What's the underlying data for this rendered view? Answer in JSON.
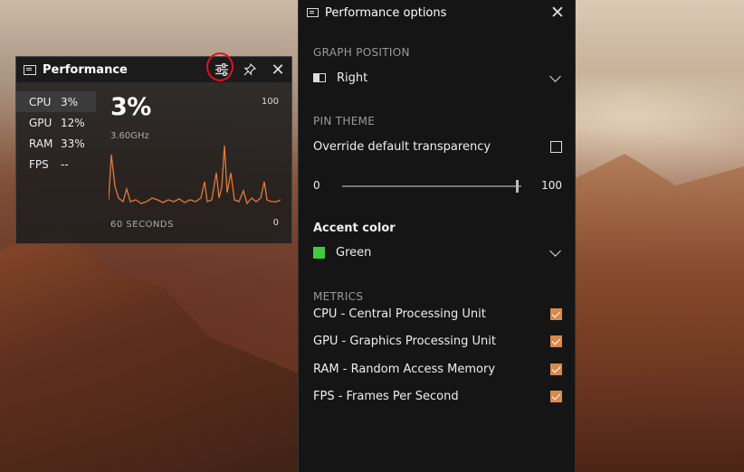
{
  "performance_widget": {
    "title": "Performance",
    "icons": {
      "app": "window-icon",
      "settings": "settings-sliders-icon",
      "pin": "pin-icon",
      "close": "close-icon"
    },
    "metrics": [
      {
        "label": "CPU",
        "value": "3%"
      },
      {
        "label": "GPU",
        "value": "12%"
      },
      {
        "label": "RAM",
        "value": "33%"
      },
      {
        "label": "FPS",
        "value": "--"
      }
    ],
    "selected_metric": "CPU",
    "current_value": "3%",
    "frequency": "3.60GHz",
    "axis_max": "100",
    "axis_min": "0",
    "time_window_label": "60 SECONDS",
    "graph_color": "#e07a3a",
    "highlight_color": "#e0101f"
  },
  "options_panel": {
    "title": "Performance options",
    "graph_position": {
      "section_label": "GRAPH POSITION",
      "value": "Right"
    },
    "pin_theme": {
      "section_label": "PIN THEME",
      "override_label": "Override default transparency",
      "override_checked": false,
      "slider_min": "0",
      "slider_max": "100",
      "slider_value_fraction": 0.97
    },
    "accent_color": {
      "label": "Accent color",
      "value": "Green",
      "swatch": "#3ccc3c"
    },
    "metrics": {
      "section_label": "METRICS",
      "items": [
        {
          "label": "CPU - Central Processing Unit",
          "checked": true
        },
        {
          "label": "GPU - Graphics Processing Unit",
          "checked": true
        },
        {
          "label": "RAM - Random Access Memory",
          "checked": true
        },
        {
          "label": "FPS - Frames Per Second",
          "checked": true
        }
      ],
      "check_color": "#d88a4a"
    }
  }
}
